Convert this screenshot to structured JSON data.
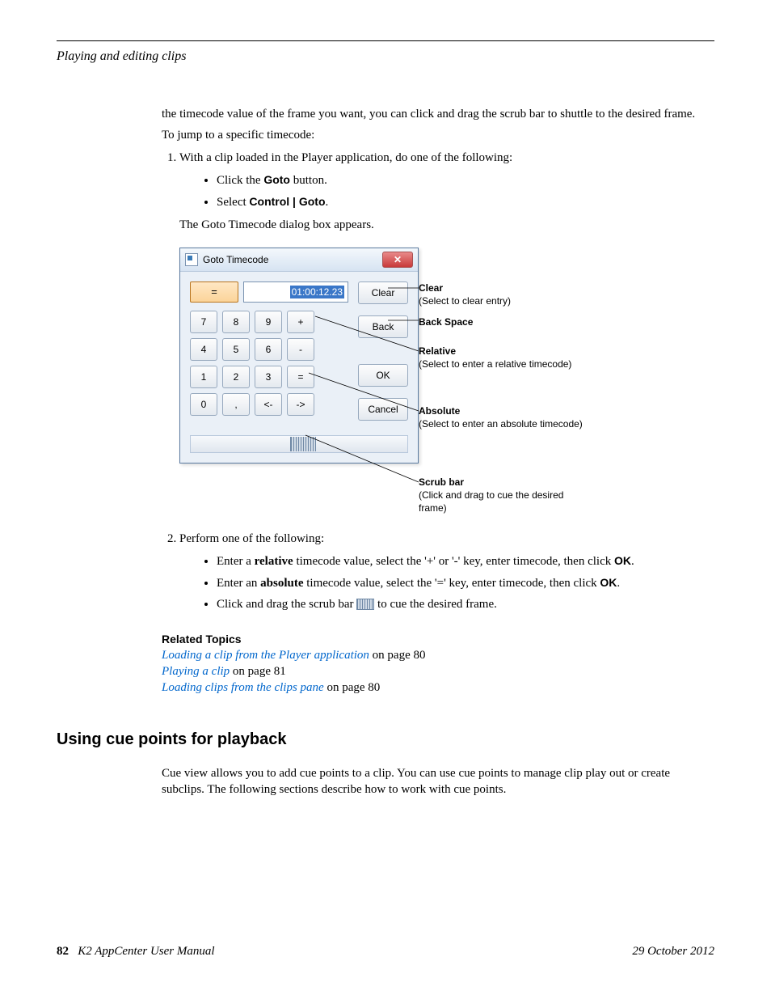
{
  "header": {
    "section": "Playing and editing clips"
  },
  "intro_para": "the timecode value of the frame you want, you can click and drag the scrub bar to shuttle to the desired frame.",
  "lead_in": "To jump to a specific timecode:",
  "step1": "With a clip loaded in the Player application, do one of the following:",
  "step1_bullets": {
    "b1_pre": "Click the ",
    "b1_bold": "Goto",
    "b1_post": " button.",
    "b2_pre": "Select ",
    "b2_bold": "Control | Goto",
    "b2_post": "."
  },
  "dlg_appears": "The Goto Timecode dialog box appears.",
  "dialog": {
    "title": "Goto Timecode",
    "timecode": "01:00:12.23",
    "keys": [
      "7",
      "8",
      "9",
      "+",
      "4",
      "5",
      "6",
      "-",
      "1",
      "2",
      "3",
      "=",
      "0",
      ",",
      "<-",
      "->"
    ],
    "side": {
      "clear": "Clear",
      "back": "Back",
      "ok": "OK",
      "cancel": "Cancel"
    }
  },
  "annot": {
    "clear_lbl": "Clear",
    "clear_sub": "(Select to clear entry)",
    "back_lbl": "Back Space",
    "rel_lbl": "Relative",
    "rel_sub": "(Select to enter a relative timecode)",
    "abs_lbl": "Absolute",
    "abs_sub": "(Select to enter an absolute timecode)",
    "scrub_lbl": "Scrub bar",
    "scrub_sub": "(Click and drag to cue the desired frame)"
  },
  "step2": "Perform one of the following:",
  "step2_bullets": {
    "r1_a": "Enter a ",
    "r1_b": "relative",
    "r1_c": " timecode value, select the '+' or '-' key, enter timecode, then click ",
    "r1_d": "OK",
    "r1_e": ".",
    "r2_a": "Enter an ",
    "r2_b": "absolute",
    "r2_c": " timecode value, select the '=' key, enter timecode, then click ",
    "r2_d": "OK",
    "r2_e": ".",
    "r3_a": "Click and drag the scrub bar ",
    "r3_b": " to cue the desired frame."
  },
  "related": {
    "heading": "Related Topics",
    "l1": "Loading a clip from the Player application",
    "p1": " on page 80",
    "l2": "Playing a clip",
    "p2": " on page 81",
    "l3": "Loading clips from the clips pane",
    "p3": " on page 80"
  },
  "h2": "Using cue points for playback",
  "h2_para": "Cue view allows you to add cue points to a clip. You can use cue points to manage clip play out or create subclips. The following sections describe how to work with cue points.",
  "footer": {
    "page": "82",
    "title": "K2 AppCenter User Manual",
    "date": "29 October 2012"
  }
}
